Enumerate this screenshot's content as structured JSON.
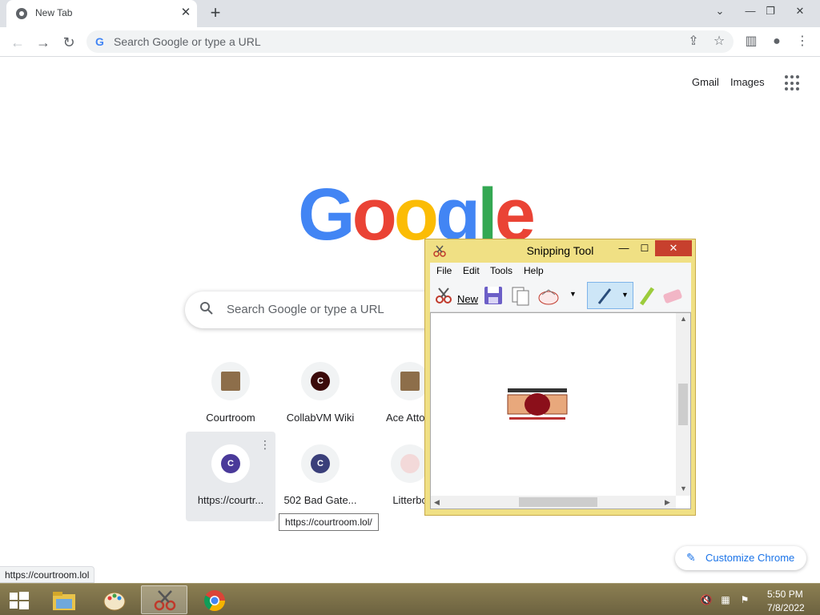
{
  "browser": {
    "tab_title": "New Tab",
    "tab_close_icon": "✕",
    "new_tab_icon": "+",
    "window_controls": {
      "tab_search": "⌄",
      "minimize": "—",
      "restore": "❐",
      "close": "✕"
    },
    "omnibox_placeholder": "Search Google or type a URL",
    "omnibox_g": "G",
    "nav": {
      "back": "←",
      "forward": "→",
      "reload": "↻"
    },
    "toolbar_icons": {
      "share": "⇪",
      "bookmark": "☆",
      "side_panel": "▥",
      "profile": "●",
      "menu": "⋮"
    }
  },
  "ntp": {
    "top_links": {
      "gmail": "Gmail",
      "images": "Images"
    },
    "logo_letters": [
      {
        "char": "G",
        "color": "#4285f4"
      },
      {
        "char": "o",
        "color": "#ea4335"
      },
      {
        "char": "o",
        "color": "#fbbc05"
      },
      {
        "char": "g",
        "color": "#4285f4"
      },
      {
        "char": "l",
        "color": "#34a853"
      },
      {
        "char": "e",
        "color": "#ea4335"
      }
    ],
    "search_placeholder": "Search Google or type a URL",
    "tiles": [
      {
        "label": "Courtroom",
        "letter": "",
        "color": "#8d6e4a"
      },
      {
        "label": "CollabVM Wiki",
        "letter": "C",
        "color": "#3b0a0a"
      },
      {
        "label": "Ace Attorn",
        "letter": "",
        "color": "#8d6e4a"
      },
      {
        "label": "https://courtr...",
        "letter": "C",
        "color": "#4a3a9a"
      },
      {
        "label": "502 Bad Gate...",
        "letter": "C",
        "color": "#3a3f7a"
      },
      {
        "label": "Litterbo",
        "letter": "",
        "color": "#f3d9d9"
      }
    ],
    "tile_menu_icon": "⋮",
    "tooltip": "https://courtroom.lol/",
    "customize_icon": "✎",
    "customize_label": "Customize Chrome",
    "status_url": "https://courtroom.lol"
  },
  "snipping_tool": {
    "title": "Snipping Tool",
    "controls": {
      "minimize": "—",
      "maximize": "☐",
      "close": "✕"
    },
    "menus": [
      "File",
      "Edit",
      "Tools",
      "Help"
    ],
    "new_label": "New",
    "scroll_arrows": {
      "up": "▲",
      "down": "▼",
      "left": "◀",
      "right": "▶"
    }
  },
  "taskbar": {
    "time": "5:50 PM",
    "date": "7/8/2022",
    "tray_icons": {
      "volume": "🔇",
      "network": "▦",
      "flag": "⚑"
    }
  }
}
